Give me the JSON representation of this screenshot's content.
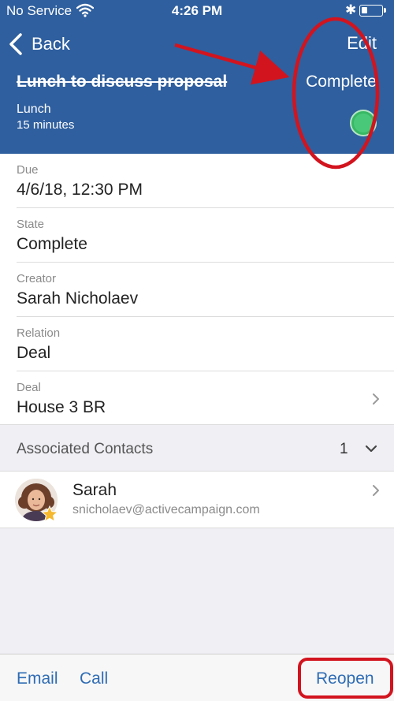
{
  "status_bar": {
    "carrier": "No Service",
    "time": "4:26 PM",
    "bluetooth_symbol": "✱",
    "battery_level": 0.3
  },
  "nav": {
    "back_label": "Back",
    "edit_label": "Edit"
  },
  "task": {
    "title": "Lunch to discuss proposal",
    "status_label": "Complete",
    "type": "Lunch",
    "duration": "15 minutes"
  },
  "fields": [
    {
      "label": "Due",
      "value": "4/6/18, 12:30 PM"
    },
    {
      "label": "State",
      "value": "Complete"
    },
    {
      "label": "Creator",
      "value": "Sarah Nicholaev"
    },
    {
      "label": "Relation",
      "value": "Deal"
    },
    {
      "label": "Deal",
      "value": "House 3 BR"
    }
  ],
  "associated_contacts": {
    "title": "Associated Contacts",
    "count": "1"
  },
  "contact": {
    "name": "Sarah",
    "email": "snicholaev@activecampaign.com"
  },
  "toolbar": {
    "email_label": "Email",
    "call_label": "Call",
    "reopen_label": "Reopen"
  },
  "colors": {
    "header_bg": "#2f5f9e",
    "link_blue": "#2e6cb4",
    "complete_green": "#38b864",
    "annotation_red": "#d2141e"
  },
  "icons": [
    "wifi-icon",
    "bluetooth-icon",
    "battery-icon",
    "back-chevron-icon",
    "complete-toggle-icon",
    "chevron-right-icon",
    "chevron-down-icon",
    "avatar",
    "star-icon"
  ]
}
